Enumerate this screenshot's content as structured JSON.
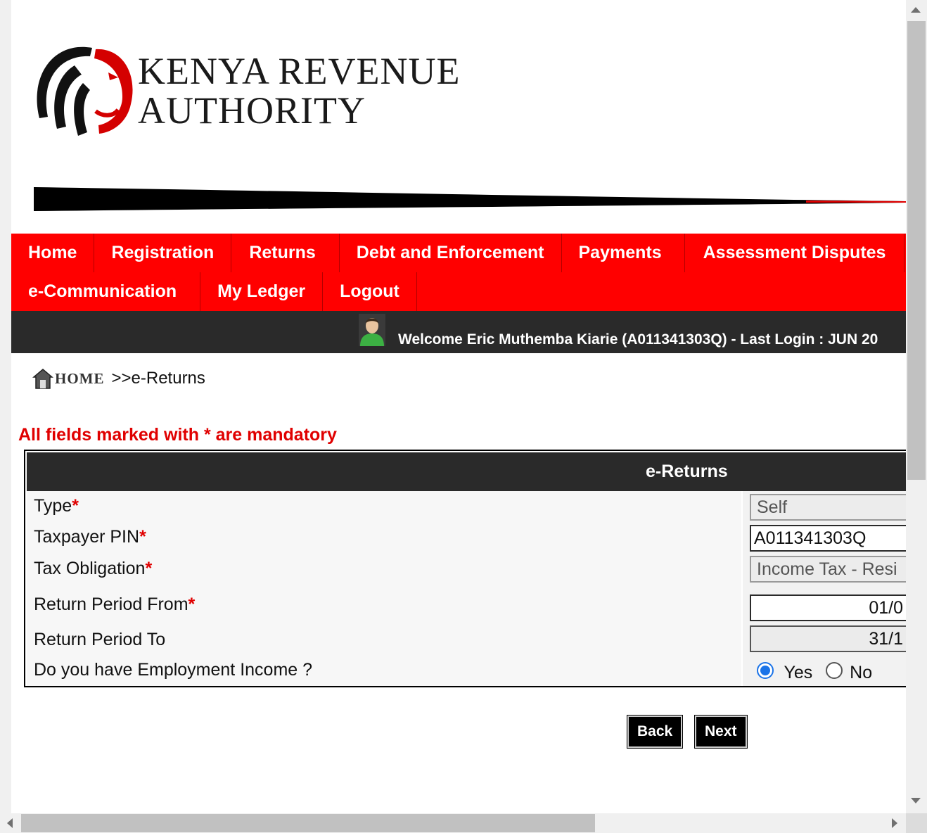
{
  "header": {
    "logo_line1": "KENYA REVENUE",
    "logo_line2": "AUTHORITY"
  },
  "nav": {
    "row1": [
      "Home",
      "Registration",
      "Returns",
      "Debt and Enforcement",
      "Payments",
      "Assessment Disputes"
    ],
    "row2": [
      "e-Communication",
      "My Ledger",
      "Logout"
    ]
  },
  "welcome": {
    "text": "Welcome Eric Muthemba Kiarie (A011341303Q)  - Last Login : JUN 20"
  },
  "breadcrumb": {
    "home": "HOME",
    "current": ">>e-Returns"
  },
  "form": {
    "mandatory_note": "All fields marked with * are mandatory",
    "title": "e-Returns",
    "required_mark": "*",
    "fields": [
      {
        "label": "Type",
        "value": "Self"
      },
      {
        "label": "Taxpayer PIN",
        "value": "A011341303Q"
      },
      {
        "label": "Tax Obligation",
        "value": "Income Tax - Resi"
      },
      {
        "label": "Return Period From",
        "value": "01/0"
      },
      {
        "label": "Return Period To",
        "value": "31/1"
      },
      {
        "label": "Do you have Employment Income ?",
        "options": [
          "Yes",
          "No"
        ],
        "selected": "Yes"
      }
    ]
  },
  "buttons": {
    "back": "Back",
    "next": "Next"
  },
  "colors": {
    "nav_red": "#ff0000",
    "dark_bar": "#2a2a2a",
    "mandatory_red": "#e00000",
    "radio_blue": "#1a73e8"
  }
}
